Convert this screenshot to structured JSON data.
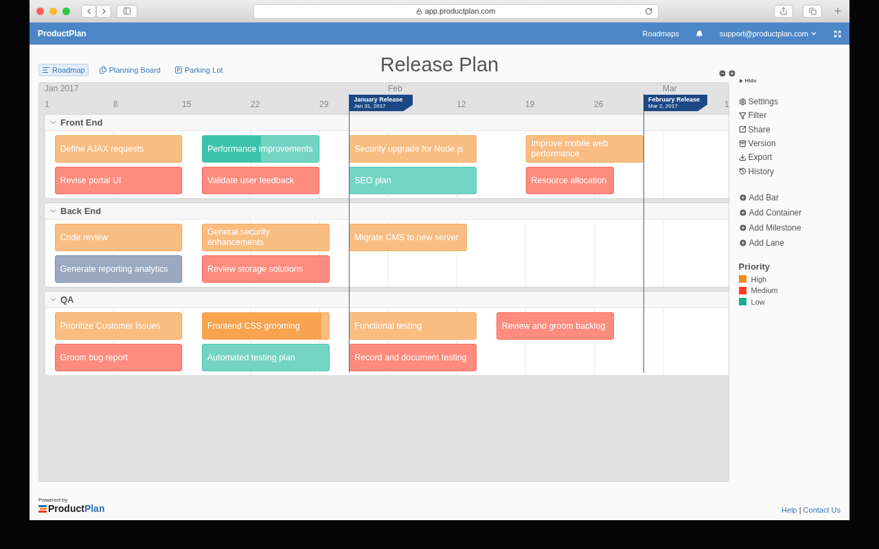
{
  "browser": {
    "url": "app.productplan.com"
  },
  "nav": {
    "brand": "ProductPlan",
    "links": [
      "Roadmaps"
    ],
    "account": "support@productplan.com"
  },
  "views": [
    {
      "label": "Roadmap",
      "kind": "roadmap",
      "selected": true
    },
    {
      "label": "Planning Board",
      "kind": "board",
      "selected": false
    },
    {
      "label": "Parking Lot",
      "kind": "parking",
      "selected": false
    }
  ],
  "title": "Release Plan",
  "timeline": {
    "months": [
      "Jan 2017",
      "Feb",
      "Mar"
    ],
    "weeks": [
      "1",
      "8",
      "15",
      "22",
      "29",
      "12",
      "19",
      "26",
      "1"
    ],
    "milestones": [
      {
        "title": "January Release",
        "date_label": "Jan 31, 2017"
      },
      {
        "title": "February Release",
        "date_label": "Mar 2, 2017"
      }
    ],
    "lanes": [
      {
        "name": "Front End",
        "expanded": true,
        "rows": [
          {
            "bars": [
              {
                "label": "Define AJAX requests",
                "color": "#f9bd82"
              },
              {
                "label": "Performance improvements",
                "color": "#74d4c3",
                "level": 0.5
              },
              {
                "label": "Security upgrade for Node.js",
                "color": "#f9bd82"
              },
              {
                "label": "Improve mobile web performance",
                "color": "#f9bd82"
              }
            ]
          },
          {
            "bars": [
              {
                "label": "Revise portal UI",
                "color": "#fd8b7e"
              },
              {
                "label": "Validate user feedback",
                "color": "#fd8b7e"
              },
              {
                "label": "SEO plan",
                "color": "#74d4c3"
              },
              {
                "label": "Resource allocation",
                "color": "#fd8b7e"
              }
            ]
          }
        ]
      },
      {
        "name": "Back End",
        "expanded": true,
        "rows": [
          {
            "bars": [
              {
                "label": "Code review",
                "color": "#f9bd82"
              },
              {
                "label": "General security enhancements",
                "color": "#f9bd82"
              },
              {
                "label": "Migrate CMS to new server",
                "color": "#f9bd82"
              }
            ]
          },
          {
            "bars": [
              {
                "label": "Generate reporting analytics",
                "color": "#9aa9c0"
              },
              {
                "label": "Review storage solutions",
                "color": "#fd8b7e"
              }
            ]
          }
        ]
      },
      {
        "name": "QA",
        "expanded": true,
        "rows": [
          {
            "bars": [
              {
                "label": "Prioritize Customer Issues",
                "color": "#f9bd82"
              },
              {
                "label": "Frontend CSS grooming",
                "color": "#f9bd82",
                "level": 0.94
              },
              {
                "label": "Functional testing",
                "color": "#f9bd82"
              },
              {
                "label": "Review and groom backlog",
                "color": "#fd8b7e"
              }
            ]
          },
          {
            "bars": [
              {
                "label": "Groom bug report",
                "color": "#fd8b7e"
              },
              {
                "label": "Automated testing plan",
                "color": "#74d4c3"
              },
              {
                "label": "Record and document testing",
                "color": "#fd8b7e"
              }
            ]
          }
        ]
      }
    ]
  },
  "sidebar": {
    "hide": "Hide",
    "tools": [
      {
        "label": "Settings",
        "kind": "settings"
      },
      {
        "label": "Filter",
        "kind": "filter"
      },
      {
        "label": "Share",
        "kind": "share"
      },
      {
        "label": "Version",
        "kind": "version"
      },
      {
        "label": "Export",
        "kind": "export"
      },
      {
        "label": "History",
        "kind": "history"
      }
    ],
    "add": [
      "Add Bar",
      "Add Container",
      "Add Milestone",
      "Add Lane"
    ],
    "legend_title": "Priority",
    "legend": [
      {
        "label": "High",
        "color": "#f7891f"
      },
      {
        "label": "Medium",
        "color": "#fb3d22"
      },
      {
        "label": "Low",
        "color": "#1aae92"
      }
    ]
  },
  "footer": {
    "powered": "Powered by",
    "logo": [
      "Product",
      "Plan"
    ],
    "links": [
      "Help",
      "Contact Us"
    ],
    "separator": "|"
  }
}
